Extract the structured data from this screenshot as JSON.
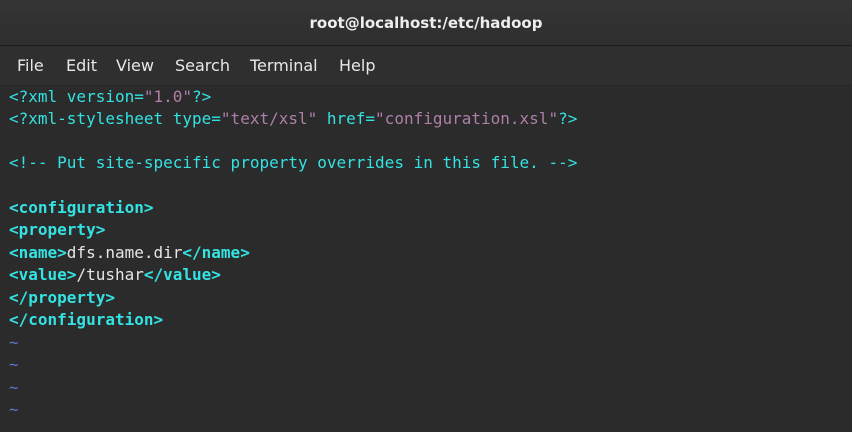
{
  "window": {
    "title": "root@localhost:/etc/hadoop"
  },
  "menu": [
    "File",
    "Edit",
    "View",
    "Search",
    "Terminal",
    "Help"
  ],
  "editor": {
    "line1": {
      "open": "<?xml version=",
      "value": "\"1.0\"",
      "close": "?>"
    },
    "line2": {
      "open": "<?xml-stylesheet type=",
      "type_value": "\"text/xsl\"",
      "href_attr": " href=",
      "href_value": "\"configuration.xsl\"",
      "close": "?>"
    },
    "comment": "<!-- Put site-specific property overrides in this file. -->",
    "config_open": "<configuration>",
    "property_open": "<property>",
    "name_open": "<name>",
    "name_value": "dfs.name.dir",
    "name_close": "</name>",
    "value_open": "<value>",
    "value_value": "/tushar",
    "value_close": "</value>",
    "property_close": "</property>",
    "config_close": "</configuration>",
    "tildes": [
      "~",
      "~",
      "~",
      "~"
    ]
  },
  "colors": {
    "background": "#2b2b2b",
    "tag": "#34e2e2",
    "string": "#ad7fa8",
    "text": "#e6e6e6",
    "tilde": "#5a78c8"
  }
}
